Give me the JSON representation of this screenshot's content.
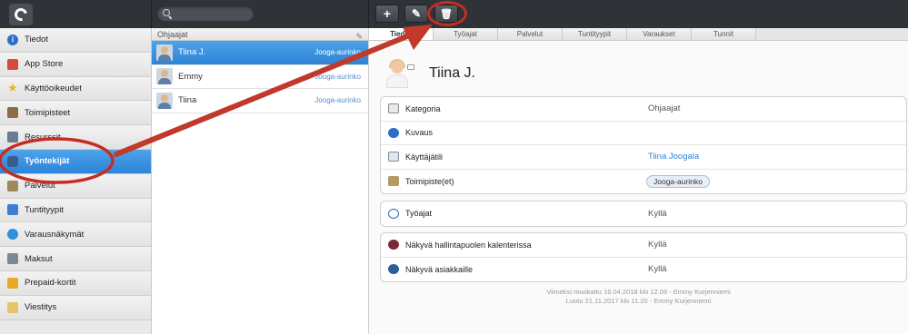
{
  "app": {
    "logo": "logo-icon"
  },
  "toolbar": {
    "search_placeholder": "",
    "buttons": [
      {
        "name": "add",
        "glyph": "+"
      },
      {
        "name": "edit",
        "glyph": "✎"
      },
      {
        "name": "delete",
        "glyph": "🗑"
      }
    ]
  },
  "sidebar": {
    "items": [
      {
        "label": "Tiedot",
        "icon": "info-icon"
      },
      {
        "label": "App Store",
        "icon": "store-icon"
      },
      {
        "label": "Käyttöoikeudet",
        "icon": "star-icon"
      },
      {
        "label": "Toimipisteet",
        "icon": "building-icon"
      },
      {
        "label": "Resurssit",
        "icon": "resource-icon"
      },
      {
        "label": "Työntekijät",
        "icon": "people-icon",
        "active": true
      },
      {
        "label": "Palvelut",
        "icon": "service-icon"
      },
      {
        "label": "Tuntityypit",
        "icon": "calendar-icon"
      },
      {
        "label": "Varausnäkymät",
        "icon": "globe-icon"
      },
      {
        "label": "Maksut",
        "icon": "payment-icon"
      },
      {
        "label": "Prepaid-kortit",
        "icon": "card-icon"
      },
      {
        "label": "Viestitys",
        "icon": "message-icon"
      }
    ]
  },
  "list": {
    "header": "Ohjaajat",
    "rows": [
      {
        "name": "Tiina J.",
        "location": "Jooga-aurinko",
        "selected": true
      },
      {
        "name": "Emmy",
        "location": "Jooga-aurinko"
      },
      {
        "name": "Tiina",
        "location": "Jooga-aurinko"
      }
    ]
  },
  "detail": {
    "tabs": [
      {
        "label": "Tiedot",
        "active": true
      },
      {
        "label": "Työajat"
      },
      {
        "label": "Palvelut"
      },
      {
        "label": "Tuntityypit"
      },
      {
        "label": "Varaukset"
      },
      {
        "label": "Tunnit"
      }
    ],
    "name": "Tiina J.",
    "info": [
      {
        "label": "Kategoria",
        "value": "Ohjaajat"
      },
      {
        "label": "Kuvaus",
        "value": ""
      },
      {
        "label": "Käyttäjätili",
        "value": "Tiina Joogala"
      },
      {
        "label": "Toimipiste(et)",
        "value": "Jooga-aurinko"
      }
    ],
    "worktime": {
      "label": "Työajat",
      "value": "Kyllä"
    },
    "visibility": [
      {
        "label": "Näkyvä hallintapuolen kalenterissa",
        "value": "Kyllä"
      },
      {
        "label": "Näkyvä asiakkaille",
        "value": "Kyllä"
      }
    ],
    "footer": {
      "modified": "Viimeksi muokattu 16.04.2018 klo 12.06 - Emmy Kurjenniemi",
      "created": "Luotu 21.11.2017 klo 11.20 - Emmy Kurjenniemi"
    }
  },
  "annotation_color": "#c62d22"
}
